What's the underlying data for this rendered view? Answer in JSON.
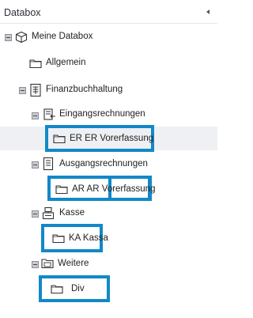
{
  "panel": {
    "title": "Databox"
  },
  "tree": {
    "root": "Meine Databox",
    "allgemein": "Allgemein",
    "finanzbuchhaltung": "Finanzbuchhaltung",
    "eingangsrechnungen": "Eingangsrechnungen",
    "er_vorerfassung": "ER ER Vorerfassung",
    "ausgangsrechnungen": "Ausgangsrechnungen",
    "ar_vorerfassung": "AR AR Vorerfassung",
    "kasse": "Kasse",
    "kassa": "KA Kassa",
    "weitere": "Weitere",
    "div": "Div"
  },
  "colors": {
    "highlight": "#1288c8",
    "selected_row": "#eef0f3"
  }
}
